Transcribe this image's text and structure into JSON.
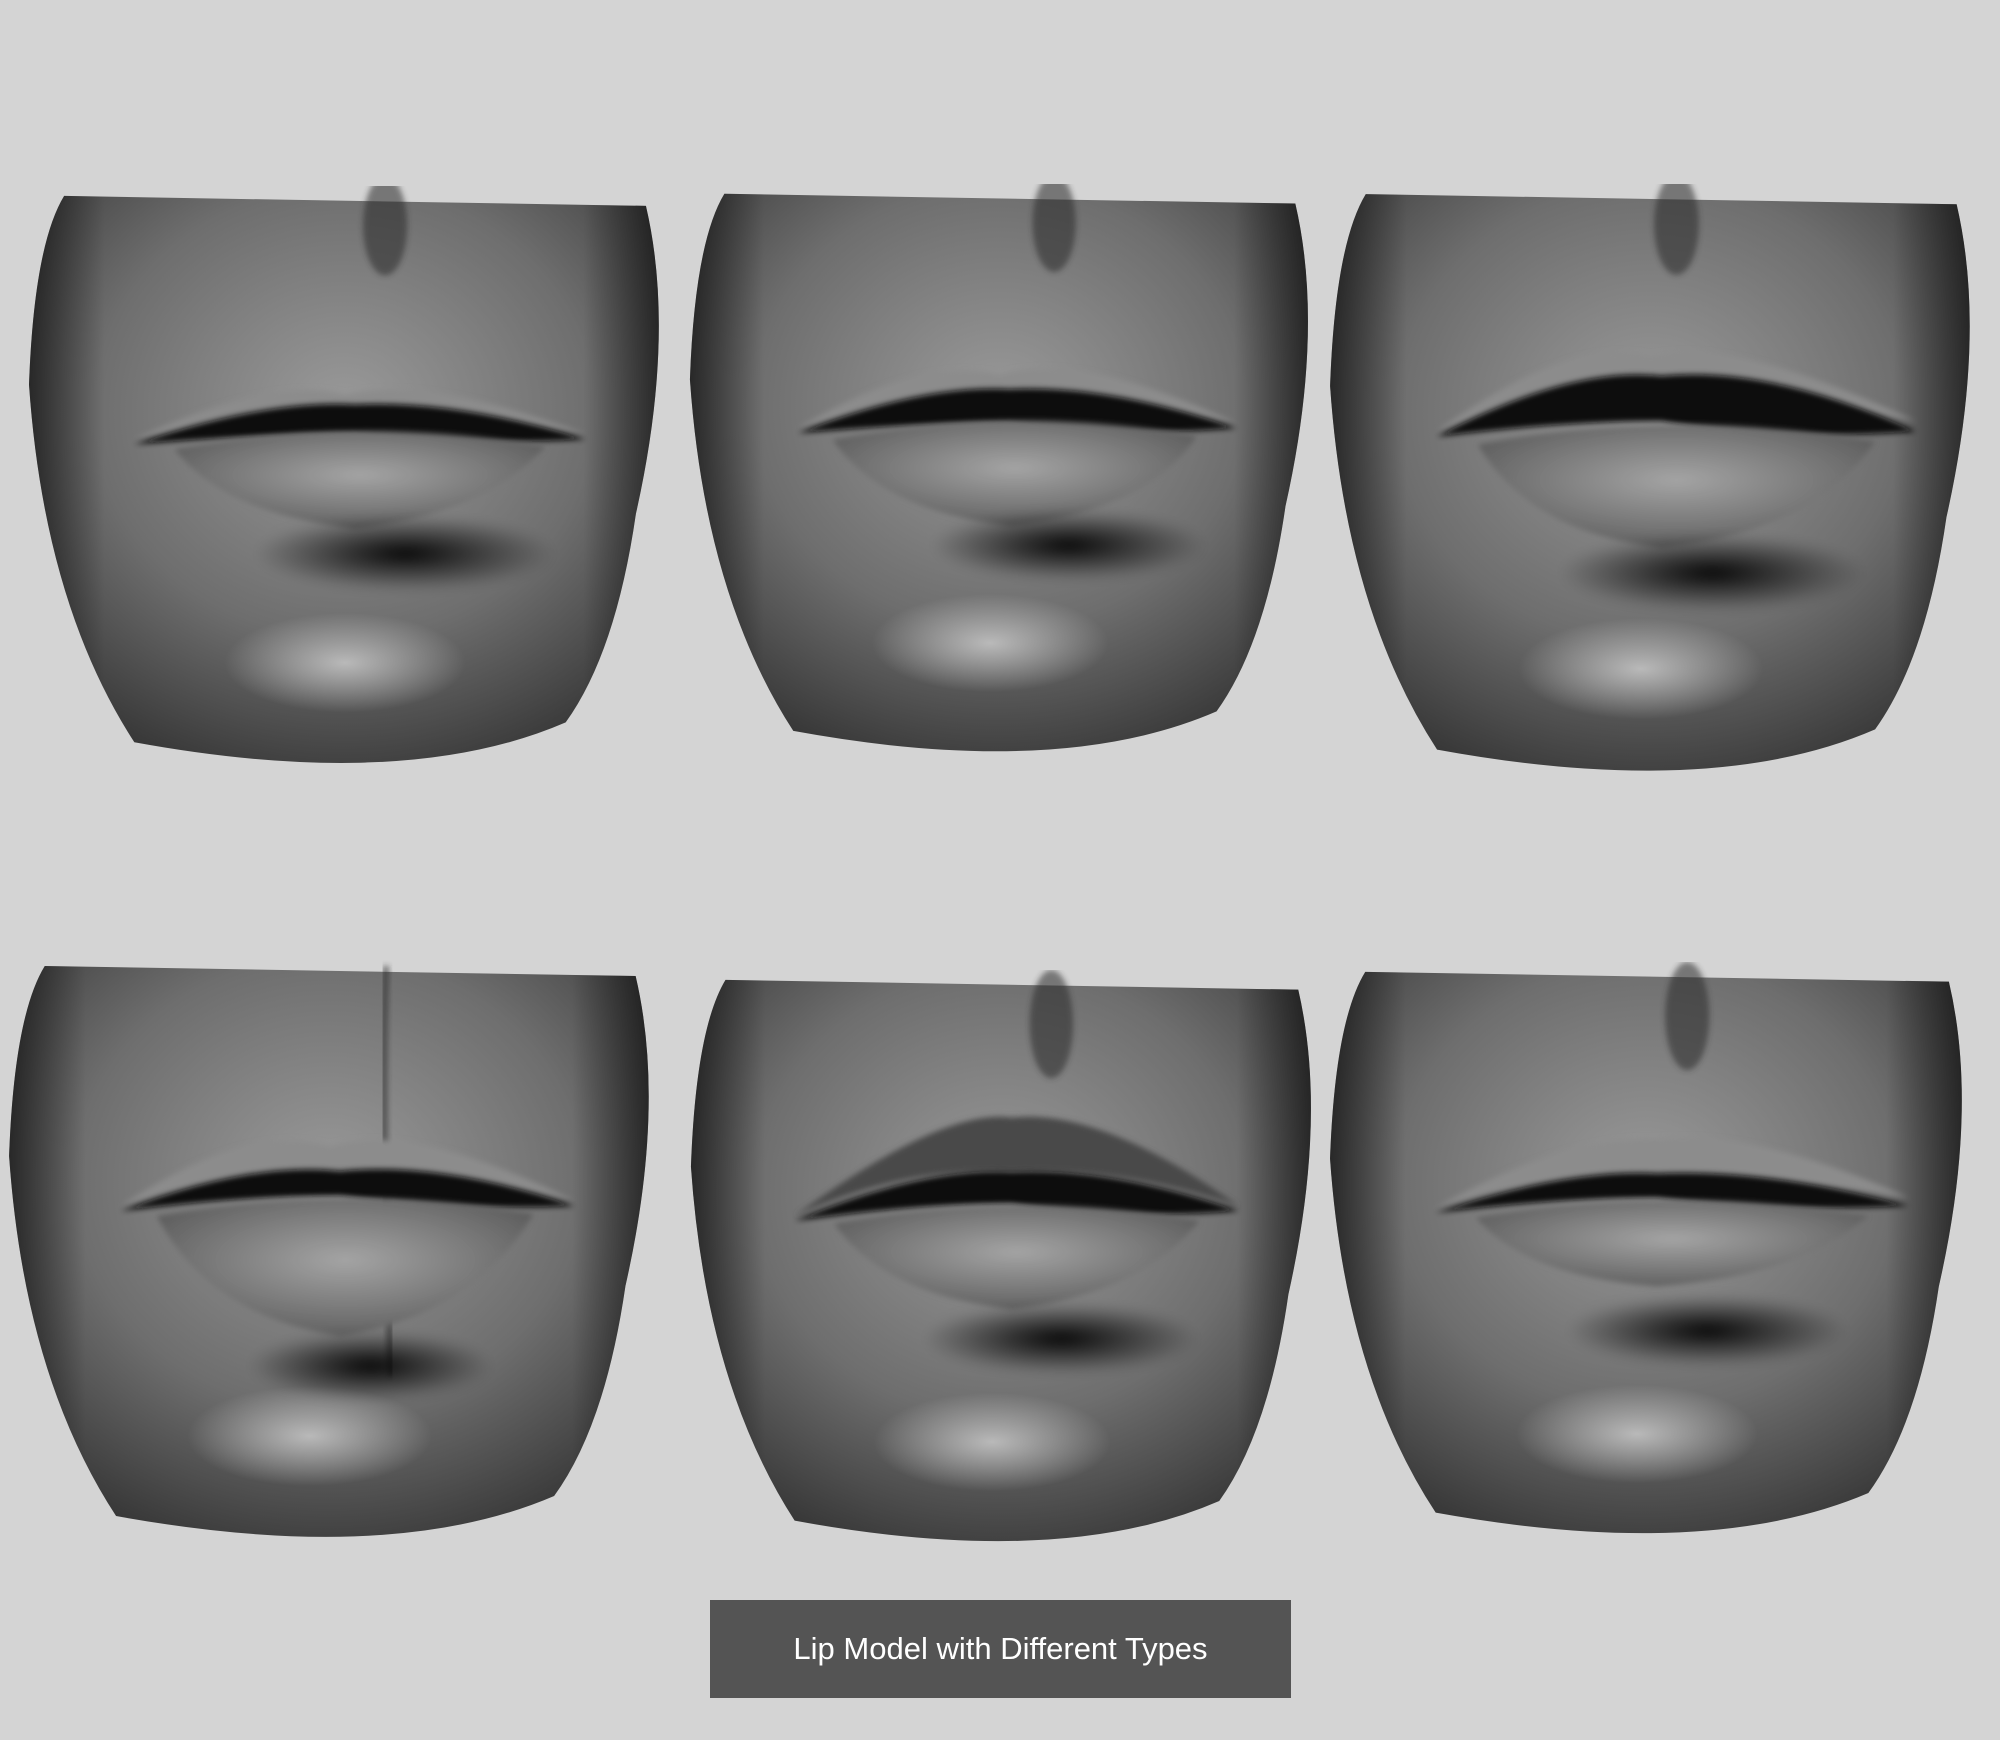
{
  "caption": {
    "text": "Lip Model with Different Types"
  },
  "colors": {
    "background": "#d4d4d4",
    "caption_bg": "#545454",
    "caption_text": "#ffffff"
  },
  "models": [
    {
      "id": "lip-model-1",
      "shape": "thin-upper-lip-slightly-parted"
    },
    {
      "id": "lip-model-2",
      "shape": "moderate-lips-parted"
    },
    {
      "id": "lip-model-3",
      "shape": "full-lips-parted"
    },
    {
      "id": "lip-model-4",
      "shape": "pursed-lips-with-center-crease"
    },
    {
      "id": "lip-model-5",
      "shape": "full-upper-lip-parted"
    },
    {
      "id": "lip-model-6",
      "shape": "thin-lips-wide-mouth"
    }
  ]
}
